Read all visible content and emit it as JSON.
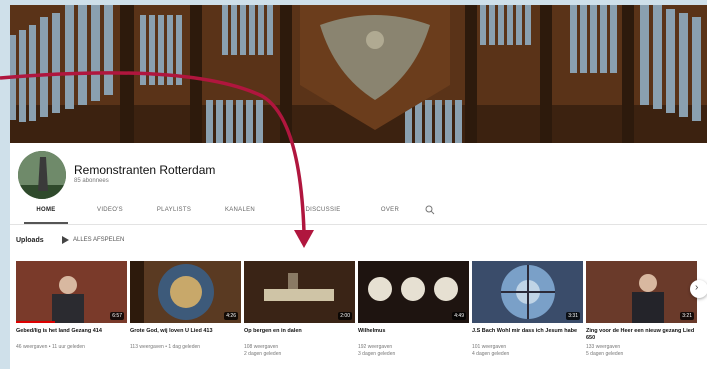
{
  "channel": {
    "name": "Remonstranten Rotterdam",
    "subscribers": "85 abonnees"
  },
  "tabs": [
    {
      "label": "HOME"
    },
    {
      "label": "VIDEO'S"
    },
    {
      "label": "PLAYLISTS"
    },
    {
      "label": "KANALEN"
    },
    {
      "label": "DISCUSSIE"
    },
    {
      "label": "OVER"
    }
  ],
  "uploads": {
    "title": "Uploads",
    "play_all": "ALLES AFSPELEN"
  },
  "videos": [
    {
      "title": "Gebed/lig is het land Gezang 414",
      "duration": "6:57",
      "views": "46 weergaven",
      "age": "11 uur geleden",
      "progress": 0.35
    },
    {
      "title": "Grote God, wij loven U Lied 413",
      "duration": "4:26",
      "views": "113 weergaven",
      "age": "1 dag geleden",
      "progress": 0
    },
    {
      "title": "Op bergen en in dalen",
      "duration": "2:00",
      "views": "108 weergaven",
      "age": "2 dagen geleden",
      "progress": 0
    },
    {
      "title": "Wilhelmus",
      "duration": "4:49",
      "views": "192 weergaven",
      "age": "3 dagen geleden",
      "progress": 0
    },
    {
      "title": "J.S Bach Wohl mir dass ich Jesum habe",
      "duration": "3:31",
      "views": "101 weergaven",
      "age": "4 dagen geleden",
      "progress": 0
    },
    {
      "title": "Zing voor de Heer een nieuw gezang Lied 650",
      "duration": "3:21",
      "views": "133 weergaven",
      "age": "5 dagen geleden",
      "progress": 0
    }
  ],
  "colors": {
    "annotation_arrow": "#b0163e",
    "progress": "#dd0000"
  },
  "icons": {
    "search": "search-icon",
    "play": "play-icon",
    "next": "chevron-right-icon"
  }
}
